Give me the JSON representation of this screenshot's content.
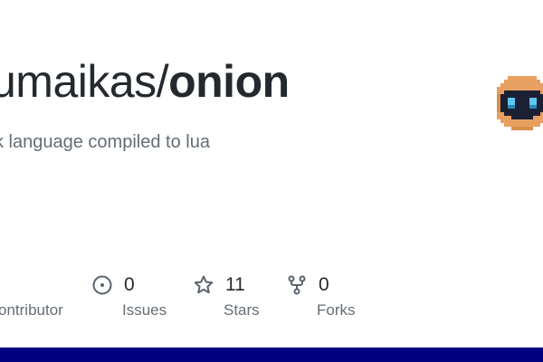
{
  "repo": {
    "owner": "umaikas",
    "separator": "/",
    "name": "onion",
    "description": "k language compiled to lua"
  },
  "avatar": {
    "icon": "pixel-robot-avatar-icon"
  },
  "stats": {
    "contributors": {
      "label": "ontributor"
    },
    "issues": {
      "count": "0",
      "label": "Issues",
      "icon": "issue-circle-icon"
    },
    "stars": {
      "count": "11",
      "label": "Stars",
      "icon": "star-icon"
    },
    "forks": {
      "count": "0",
      "label": "Forks",
      "icon": "fork-icon"
    }
  },
  "colors": {
    "title": "#24292f",
    "muted": "#656d76",
    "bottom_bar": "#000080",
    "avatar_orange": "#e8a060",
    "avatar_dark": "#1c2035",
    "avatar_eyes": "#5ec8f0"
  }
}
